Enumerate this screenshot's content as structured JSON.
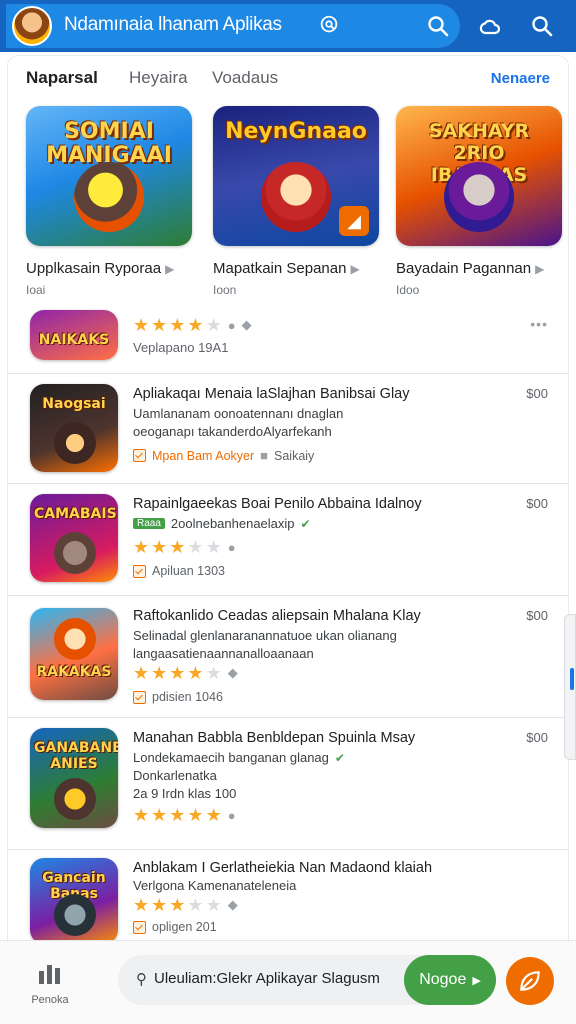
{
  "header": {
    "title": "Ndamınaia lhanam Aplikas",
    "icons": [
      "avatar",
      "chat-search-icon",
      "search-icon",
      "cloud-icon",
      "search-icon"
    ]
  },
  "tabs": [
    {
      "label": "Naparsal",
      "active": true
    },
    {
      "label": "Heyaira",
      "active": false
    },
    {
      "label": "Voadaus",
      "active": false
    }
  ],
  "tabs_link": "Nenaere",
  "featured": [
    {
      "art": "SOMIAI MANIGAAI",
      "name": "Upplkasain Ryporaa",
      "sub": "Ioai"
    },
    {
      "art": "NeynGnaao",
      "name": "Mapatkain Sepanan",
      "sub": "Ioon"
    },
    {
      "art": "SAKHAYR 2RIO IBANNAS",
      "name": "Bayadain Pagannan",
      "sub": "Idoo"
    }
  ],
  "list": [
    {
      "art": "NAIKAKS",
      "rating": 3.5,
      "meta": "Veplapano  19A1",
      "price": ""
    },
    {
      "art": "Naogsai",
      "title": "Apliakaqaı Menaia laSlajhan Banibsai Glay",
      "line1": "Uamlananam oonoatennanı dnaglan",
      "line2": "oeoganapı takanderdoAlyarfekanh",
      "tag": "Mpan Bam Aokyer",
      "tag2": "Saikaiy",
      "price": "$00"
    },
    {
      "art": "CAMABAIS",
      "title": "Rapainlgaeekas Boai Penilo Abbaina Idalnoy",
      "badge": "Raaa",
      "line1": "2oolnebanhenaelaxip",
      "rating": 2.5,
      "meta": "Apiluan  1303",
      "price": "$00"
    },
    {
      "art": "RAKAKAS",
      "title": "Raftokanlido Ceadas aliepsain Mhalana Klay",
      "line1": "Selinadal glenlanaranannatuoe ukan olianang",
      "line2": "langaasatienaannanalloaanaan",
      "rating": 4,
      "meta": "pdisien  1046",
      "price": "$00"
    },
    {
      "art": "GANABANE ANIES",
      "title": "Manahan Babbla Benbldepan Spuinla Msay",
      "line1": "Londekamaecih banganan glanag",
      "line2": "Donkarlenatka",
      "line3": "2a 9 Irdn klas 100",
      "rating": 5,
      "price": "$00"
    },
    {
      "art": "Gancain Banas",
      "title": "Anblakam I Gerlatheiekia Nan Madaond klaiah",
      "line1": "Verlgona Kamenanateleneia",
      "rating": 3,
      "meta": "opligen  201",
      "price": ""
    }
  ],
  "bottom": {
    "nav_label": "Penoka",
    "search_placeholder": "Uleuliam:Glekr Aplikayar Slagusm",
    "go_label": "Nogoe"
  }
}
